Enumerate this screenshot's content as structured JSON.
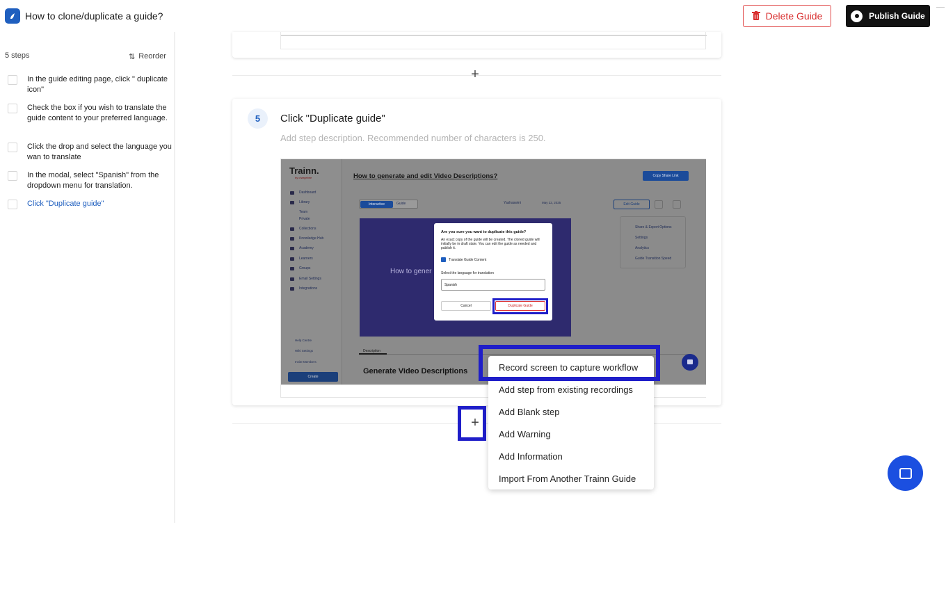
{
  "header": {
    "title": "How to clone/duplicate a guide?",
    "delete_label": "Delete Guide",
    "publish_label": "Publish Guide"
  },
  "sidebar": {
    "steps_count": "5 steps",
    "reorder_label": "Reorder",
    "steps": [
      {
        "text": "In the guide editing page, click \" duplicate icon\"",
        "active": false
      },
      {
        "text": "Check the box if you wish to translate the guide content to your preferred language.",
        "active": false
      },
      {
        "text": "Click the drop and select the language you wan to translate",
        "active": false
      },
      {
        "text": "In the modal, select \"Spanish\" from the dropdown menu for translation.",
        "active": false
      },
      {
        "text": "Click \"Duplicate guide\"",
        "active": true
      }
    ]
  },
  "step": {
    "number": "5",
    "title": "Click \"Duplicate guide\"",
    "description_placeholder": "Add step description. Recommended number of characters is 250."
  },
  "screenshot": {
    "logo": "Trainn.",
    "logo_sub": "by chargebee",
    "nav": [
      "Dashboard",
      "Library",
      "Team",
      "Private",
      "Collections",
      "Knowledge Hub",
      "Academy",
      "Learners",
      "Groups",
      "Email Settings",
      "Integrations"
    ],
    "help": [
      "Help Centre",
      "Wiki Settings",
      "Invite Members"
    ],
    "create_label": "Create",
    "page_title": "How to generate and edit Video Descriptions?",
    "copy_share_label": "Copy Share Link",
    "tab_interactive": "Interactive",
    "tab_guide": "Guide",
    "author": "Yashaswini",
    "date": "May 22, 2025",
    "edit_guide_label": "Edit Guide",
    "share_menu": [
      "Share & Export Options",
      "Settings",
      "Analytics",
      "Guide Transition Speed"
    ],
    "video_text": "How to gener",
    "description_tab": "Description",
    "generate_heading": "Generate Video Descriptions",
    "modal": {
      "title": "Are you sure you want to duplicate this guide?",
      "body": "An exact copy of the guide will be created. The cloned guide will initially be in draft state. You can edit the guide as needed and publish it.",
      "checkbox_label": "Translate Guide Content",
      "select_label": "Select the language for translation",
      "select_value": "Spanish",
      "cancel_label": "Cancel",
      "duplicate_label": "Duplicate Guide"
    }
  },
  "add_menu": {
    "items": [
      "Record screen to capture workflow",
      "Add step from existing recordings",
      "Add Blank step",
      "Add Warning",
      "Add Information",
      "Import From Another Trainn Guide"
    ]
  },
  "colors": {
    "accent": "#1f5fbf",
    "highlight": "#1f1ec9",
    "danger": "#d93030",
    "chat": "#1b4fe0"
  }
}
